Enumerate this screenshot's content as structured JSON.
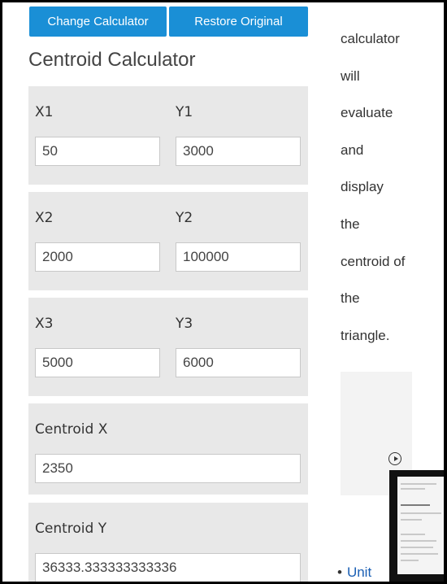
{
  "toolbar": {
    "change_label": "Change Calculator",
    "restore_label": "Restore Original",
    "accent": "#1a8fd6"
  },
  "page_title": "Centroid Calculator",
  "fields": {
    "x1": {
      "label": "X1",
      "value": "50"
    },
    "y1": {
      "label": "Y1",
      "value": "3000"
    },
    "x2": {
      "label": "X2",
      "value": "2000"
    },
    "y2": {
      "label": "Y2",
      "value": "100000"
    },
    "x3": {
      "label": "X3",
      "value": "5000"
    },
    "y3": {
      "label": "Y3",
      "value": "6000"
    }
  },
  "results": {
    "centroid_x": {
      "label": "Centroid X",
      "value": "2350"
    },
    "centroid_y": {
      "label": "Centroid Y",
      "value": "36333.333333333336"
    }
  },
  "sidebar": {
    "lines": [
      "calculator",
      "will",
      "evaluate",
      "and",
      "display",
      "the",
      "centroid of",
      "the",
      "triangle."
    ],
    "link_label": "Unit"
  },
  "icons": {
    "video_play": "play-circle-icon"
  }
}
